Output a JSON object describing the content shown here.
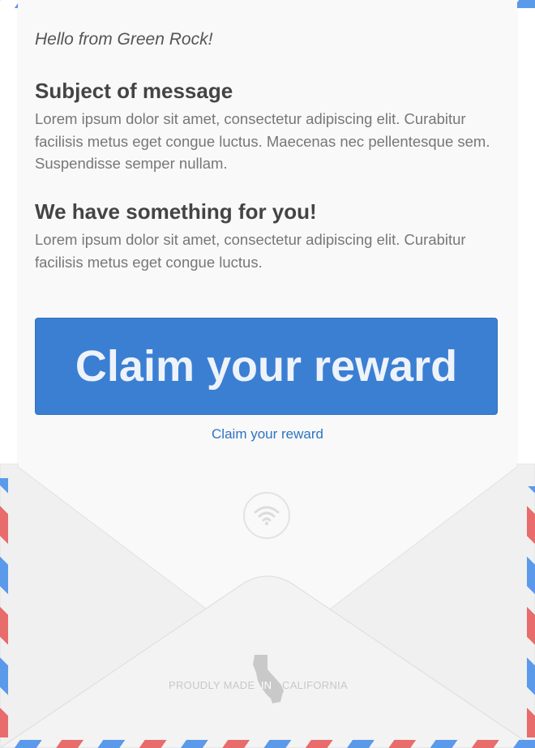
{
  "greeting": "Hello from Green Rock!",
  "sections": [
    {
      "heading": "Subject of message",
      "body": "Lorem ipsum dolor sit amet, consectetur adipiscing elit. Curabitur facilisis metus eget congue luctus. Maecenas nec pellentesque sem. Suspendisse semper nullam."
    },
    {
      "heading": "We have something for you!",
      "body": "Lorem ipsum dolor sit amet, consectetur adipiscing elit. Curabitur facilisis metus eget congue luctus."
    }
  ],
  "cta": {
    "button_label": "Claim your reward",
    "link_label": "Claim your reward"
  },
  "icons": {
    "signal": "wifi-icon",
    "state": "california-map-icon"
  },
  "footer": {
    "left": "PROUDLY MADE",
    "middle": "IN",
    "right": "CALIFORNIA"
  },
  "colors": {
    "accent": "#3b7fd3",
    "link": "#2d73c2",
    "stripe_blue": "#5b9aea",
    "stripe_red": "#e86c6c",
    "paper": "#f9f9f9"
  }
}
